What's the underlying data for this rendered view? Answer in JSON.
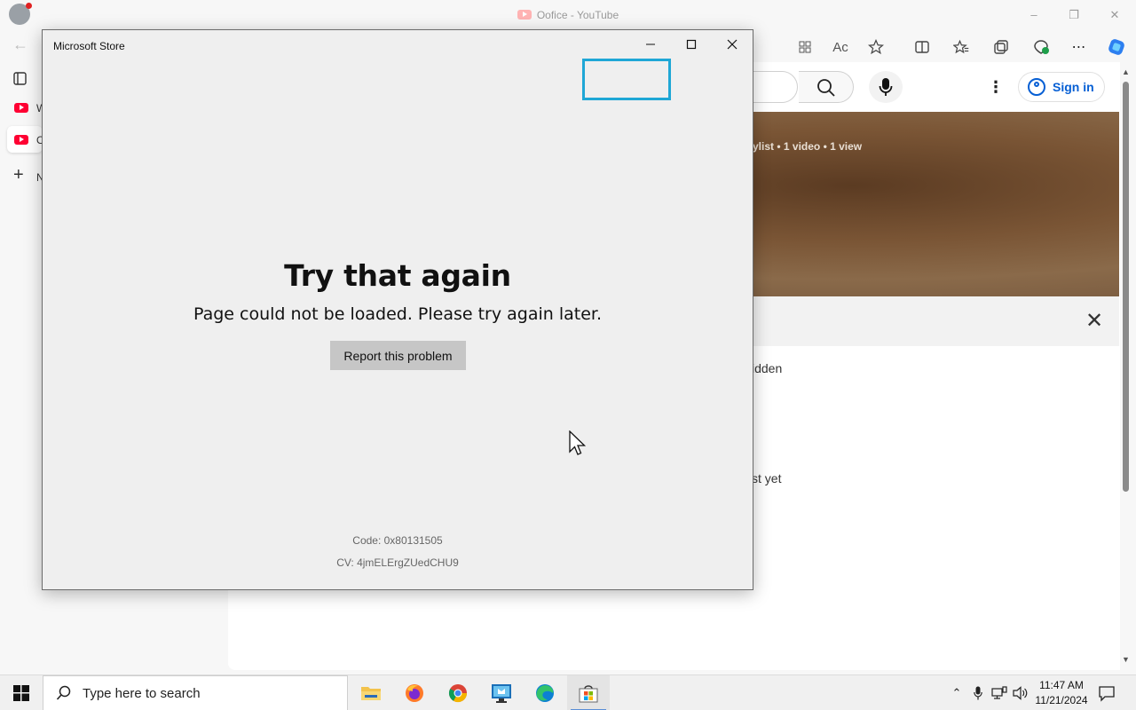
{
  "browser": {
    "tab_title": "Oofice - YouTube",
    "side_tabs": [
      {
        "label": "W"
      },
      {
        "label": "O"
      },
      {
        "label": "N"
      }
    ],
    "signin_label": "Sign in",
    "banner_meta": "ylist • 1 video • 1 view",
    "panel_text_1": "idden",
    "panel_text_2": "st yet"
  },
  "store_window": {
    "title": "Microsoft Store",
    "error_title": "Try that again",
    "error_message": "Page could not be loaded. Please try again later.",
    "report_button": "Report this problem",
    "code": "Code: 0x80131505",
    "cv": "CV: 4jmELErgZUedCHU9"
  },
  "taskbar": {
    "search_placeholder": "Type here to search",
    "apps": [
      "file-explorer",
      "firefox",
      "chrome",
      "remote-desktop",
      "edge",
      "microsoft-store"
    ],
    "active_app": "microsoft-store",
    "time": "11:47 AM",
    "date": "11/21/2024"
  },
  "colors": {
    "focus_ring": "#1fa7d6",
    "youtube_red": "#ff0033",
    "signin_blue": "#065fd4"
  }
}
